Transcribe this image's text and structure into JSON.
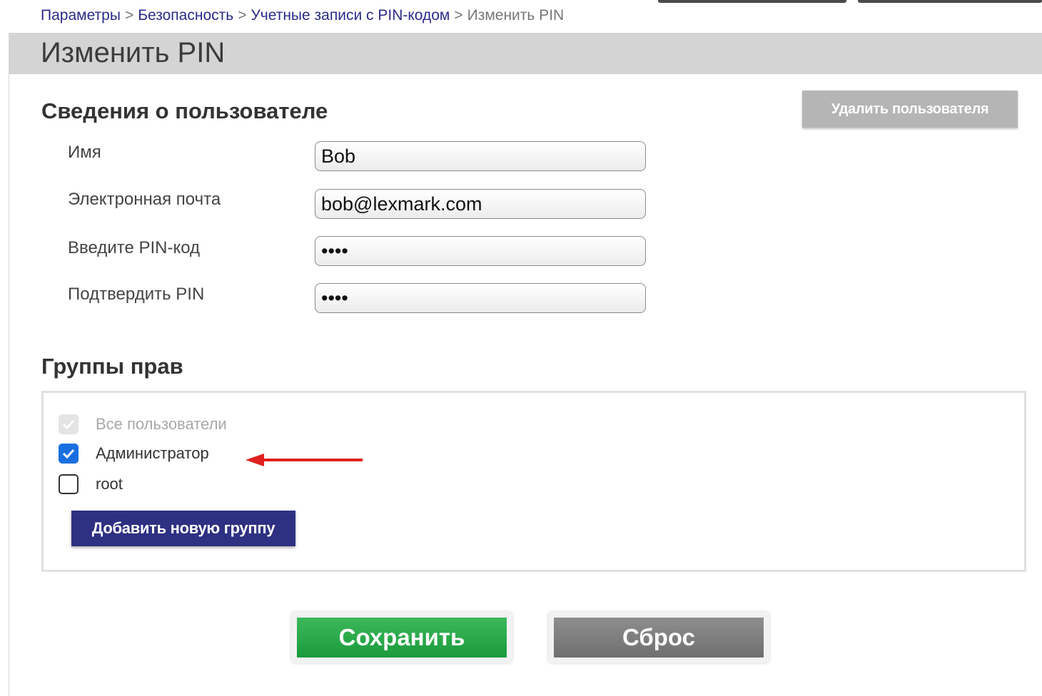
{
  "breadcrumb": {
    "items": [
      "Параметры",
      "Безопасность",
      "Учетные записи с PIN-кодом"
    ],
    "current": "Изменить PIN",
    "separator": ">"
  },
  "page": {
    "title": "Изменить PIN"
  },
  "user_info": {
    "heading": "Сведения о пользователе",
    "delete_button": "Удалить пользователя",
    "fields": {
      "name": {
        "label": "Имя",
        "value": "Bob"
      },
      "email": {
        "label": "Электронная почта",
        "value": "bob@lexmark.com"
      },
      "pin": {
        "label": "Введите PIN-код",
        "value": "1234"
      },
      "confirm_pin": {
        "label": "Подтвердить PIN",
        "value": "1234"
      }
    }
  },
  "groups": {
    "heading": "Группы прав",
    "items": [
      {
        "label": "Все пользователи",
        "checked": true,
        "disabled": true
      },
      {
        "label": "Администратор",
        "checked": true,
        "disabled": false
      },
      {
        "label": "root",
        "checked": false,
        "disabled": false
      }
    ],
    "add_button": "Добавить новую группу"
  },
  "actions": {
    "save": "Сохранить",
    "reset": "Сброс"
  },
  "colors": {
    "accent": "#2e3082",
    "save": "#1a9a3c",
    "checkbox": "#1a6fe0",
    "annotation_arrow": "#e02020"
  },
  "icons": {
    "annotation": "red-arrow-icon",
    "check": "checkmark-icon"
  }
}
